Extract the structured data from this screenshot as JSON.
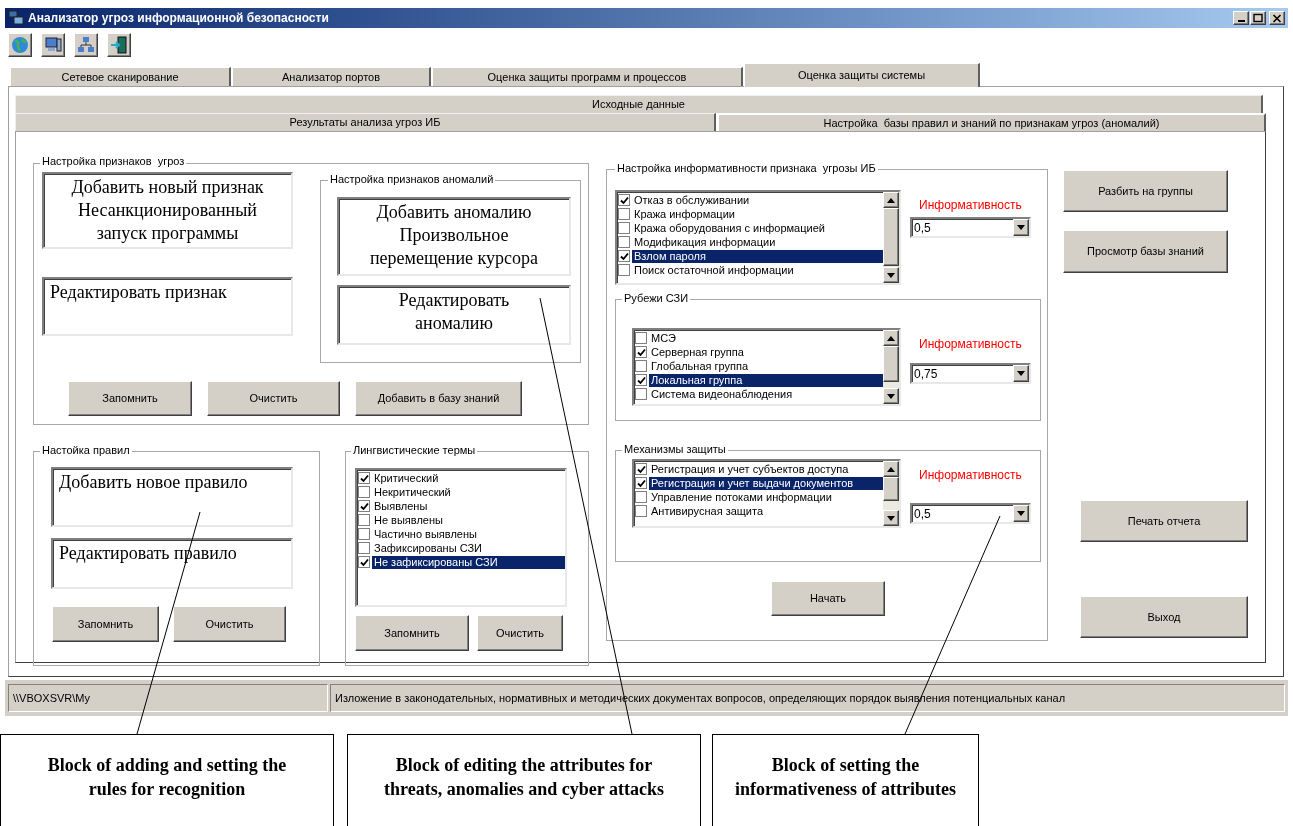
{
  "window": {
    "title": "Анализатор угроз информационной безопасности"
  },
  "tabs": [
    {
      "label": "Сетевое сканирование",
      "selected": false
    },
    {
      "label": "Анализатор портов",
      "selected": false
    },
    {
      "label": "Оценка защиты программ и процессов",
      "selected": false
    },
    {
      "label": "Оценка защиты системы",
      "selected": true
    }
  ],
  "subtab_rows": [
    [
      {
        "label": "Исходные данные",
        "selected": false
      }
    ],
    [
      {
        "label": "Результаты анализа угроз ИБ",
        "selected": false
      },
      {
        "label": "Настройка  базы правил и знаний по признакам угроз (аномалий)",
        "selected": true
      }
    ]
  ],
  "threat_features": {
    "title": "Настройка признаков  угроз",
    "add_text": "Добавить новый признак\nНесанкционированный\nзапуск программы",
    "edit_text": "Редактировать признак",
    "buttons": [
      "Запомнить",
      "Очистить",
      "Добавить в базу знаний"
    ]
  },
  "anomalies": {
    "title": "Настройка признаков аномалий",
    "add_text": "Добавить аномалию\nПроизвольное\nперемещение курсора",
    "edit_text": "Редактировать\nаномалию"
  },
  "rules": {
    "title": "Настойка правил",
    "add_text": "Добавить новое правило",
    "edit_text": "Редактировать  правило",
    "buttons": [
      "Запомнить",
      "Очистить"
    ]
  },
  "terms": {
    "title": "Лингвистические термы",
    "items": [
      {
        "label": "Критический",
        "checked": true,
        "selected": false
      },
      {
        "label": "Некритический",
        "checked": false,
        "selected": false
      },
      {
        "label": "Выявлены",
        "checked": true,
        "selected": false
      },
      {
        "label": "Не выявлены",
        "checked": false,
        "selected": false
      },
      {
        "label": "Частично выявлены",
        "checked": false,
        "selected": false
      },
      {
        "label": "Зафиксированы СЗИ",
        "checked": false,
        "selected": false
      },
      {
        "label": "Не зафиксированы СЗИ",
        "checked": true,
        "selected": true
      }
    ],
    "buttons": [
      "Запомнить",
      "Очистить"
    ]
  },
  "informativeness": {
    "title": "Настройка информативности признака  угрозы ИБ",
    "sections": [
      {
        "items": [
          {
            "label": "Отказ в обслуживании",
            "checked": true,
            "selected": false
          },
          {
            "label": "Кража информации",
            "checked": false,
            "selected": false
          },
          {
            "label": "Кража оборудования с информацией",
            "checked": false,
            "selected": false
          },
          {
            "label": "Модификация информации",
            "checked": false,
            "selected": false
          },
          {
            "label": "Взлом пароля",
            "checked": true,
            "selected": true
          },
          {
            "label": "Поиск остаточной информации",
            "checked": false,
            "selected": false
          }
        ],
        "label": "Информативность",
        "value": "0,5"
      },
      {
        "title": "Рубежи СЗИ",
        "items": [
          {
            "label": "МСЭ",
            "checked": false,
            "selected": false
          },
          {
            "label": "Серверная группа",
            "checked": true,
            "selected": false
          },
          {
            "label": "Глобальная группа",
            "checked": false,
            "selected": false
          },
          {
            "label": "Локальная группа",
            "checked": true,
            "selected": true
          },
          {
            "label": "Система видеонаблюдения",
            "checked": false,
            "selected": false
          }
        ],
        "label": "Информативность",
        "value": "0,75"
      },
      {
        "title": "Механизмы защиты",
        "items": [
          {
            "label": "Регистрация и учет субъектов доступа",
            "checked": true,
            "selected": false
          },
          {
            "label": "Регистрация и учет выдачи документов",
            "checked": true,
            "selected": true
          },
          {
            "label": "Управление потоками информации",
            "checked": false,
            "selected": false
          },
          {
            "label": "Антивирусная защита",
            "checked": false,
            "selected": false
          }
        ],
        "label": "Информативность",
        "value": "0,5"
      }
    ],
    "button": "Начать"
  },
  "side_buttons": [
    "Разбить на группы",
    "Просмотр базы знаний",
    "Печать отчета",
    "Выход"
  ],
  "status_bar": [
    "\\\\VBOXSVR\\My",
    "Изложение в законодательных, нормативных и методических документах вопросов, определяющих порядок выявления потенциальных канал"
  ],
  "annotations": [
    "Block of adding and setting the\nrules for recognition",
    "Block of editing the attributes for\nthreats, anomalies and cyber attacks",
    "Block of setting the\ninformativeness of attributes"
  ]
}
